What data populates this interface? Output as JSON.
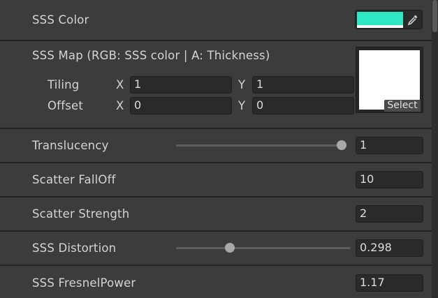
{
  "sss_color": {
    "label": "SSS Color",
    "swatch_color": "#2de8c2",
    "picker_icon": "eyedropper-icon"
  },
  "sss_map": {
    "label": "SSS Map (RGB: SSS color | A: Thickness)",
    "tiling": {
      "label": "Tiling",
      "x_label": "X",
      "x_value": "1",
      "y_label": "Y",
      "y_value": "1"
    },
    "offset": {
      "label": "Offset",
      "x_label": "X",
      "x_value": "0",
      "y_label": "Y",
      "y_value": "0"
    },
    "select_label": "Select"
  },
  "translucency": {
    "label": "Translucency",
    "value": "1",
    "slider_fraction": 1.0
  },
  "scatter_falloff": {
    "label": "Scatter FallOff",
    "value": "10"
  },
  "scatter_strength": {
    "label": "Scatter Strength",
    "value": "2"
  },
  "sss_distortion": {
    "label": "SSS Distortion",
    "value": "0.298",
    "slider_fraction": 0.298
  },
  "sss_fresnel_power": {
    "label": "SSS FresnelPower",
    "value": "1.17"
  },
  "colors": {
    "panel_bg": "#3c3c3c",
    "field_bg": "#2a2a2a",
    "accent_swatch": "#2de8c2"
  }
}
